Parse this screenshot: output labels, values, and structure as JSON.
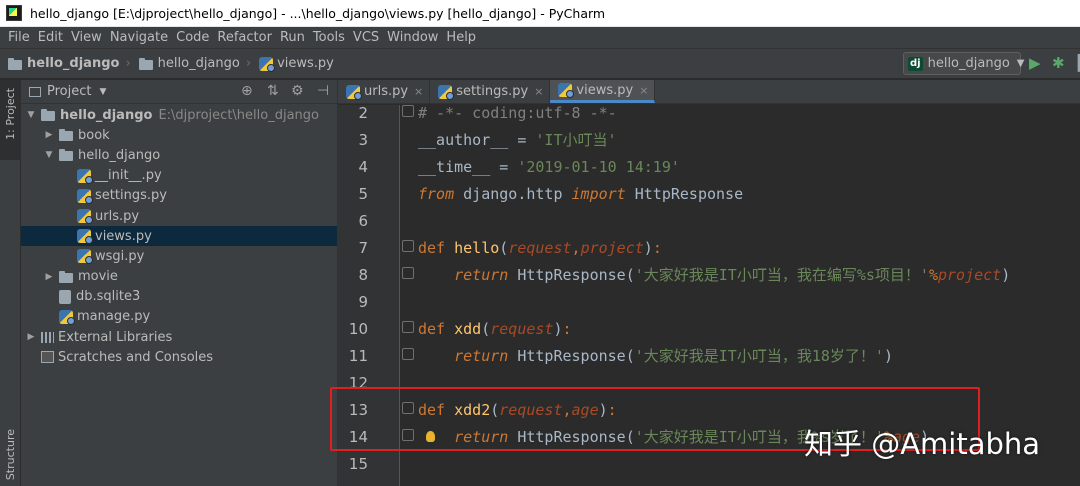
{
  "window": {
    "title": "hello_django [E:\\djproject\\hello_django] - ...\\hello_django\\views.py [hello_django] - PyCharm"
  },
  "menubar": {
    "items": [
      "File",
      "Edit",
      "View",
      "Navigate",
      "Code",
      "Refactor",
      "Run",
      "Tools",
      "VCS",
      "Window",
      "Help"
    ]
  },
  "breadcrumbs": [
    "hello_django",
    "hello_django",
    "views.py"
  ],
  "run_config": {
    "label": "hello_django",
    "badge": "dj"
  },
  "side_tabs": {
    "project": "1: Project",
    "structure": "Structure"
  },
  "project_panel": {
    "header": "Project",
    "tree": [
      {
        "label": "hello_django",
        "path": "E:\\djproject\\hello_django",
        "icon": "folder-icon",
        "expanded": true,
        "depth": 0,
        "bold": true
      },
      {
        "label": "book",
        "icon": "folder-icon",
        "expanded": false,
        "depth": 1
      },
      {
        "label": "hello_django",
        "icon": "folder-icon",
        "expanded": true,
        "depth": 1
      },
      {
        "label": "__init__.py",
        "icon": "python-file-icon",
        "depth": 2
      },
      {
        "label": "settings.py",
        "icon": "python-file-icon",
        "depth": 2
      },
      {
        "label": "urls.py",
        "icon": "python-file-icon",
        "depth": 2
      },
      {
        "label": "views.py",
        "icon": "python-file-icon",
        "depth": 2,
        "selected": true
      },
      {
        "label": "wsgi.py",
        "icon": "python-file-icon",
        "depth": 2
      },
      {
        "label": "movie",
        "icon": "folder-icon",
        "expanded": false,
        "depth": 1
      },
      {
        "label": "db.sqlite3",
        "icon": "database-icon",
        "depth": 1
      },
      {
        "label": "manage.py",
        "icon": "python-file-icon",
        "depth": 1
      },
      {
        "label": "External Libraries",
        "icon": "library-icon",
        "expanded": false,
        "depth": 0
      },
      {
        "label": "Scratches and Consoles",
        "icon": "scratch-icon",
        "depth": 0
      }
    ]
  },
  "editor": {
    "tabs": [
      {
        "label": "urls.py",
        "active": false
      },
      {
        "label": "settings.py",
        "active": false
      },
      {
        "label": "views.py",
        "active": true
      }
    ],
    "lines": [
      {
        "no": "2",
        "tokens": [
          [
            "c-comment",
            "# -*- coding:utf-8 -*-"
          ]
        ],
        "fold": true
      },
      {
        "no": "3",
        "tokens": [
          [
            "c-dunder",
            "__author__"
          ],
          [
            "",
            " = "
          ],
          [
            "c-str",
            "'IT小叮当'"
          ]
        ]
      },
      {
        "no": "4",
        "tokens": [
          [
            "c-dunder",
            "__time__"
          ],
          [
            "",
            " = "
          ],
          [
            "c-str",
            "'2019-01-10 14:19'"
          ]
        ]
      },
      {
        "no": "5",
        "tokens": [
          [
            "c-kw",
            "from"
          ],
          [
            "",
            " django.http "
          ],
          [
            "c-kw",
            "import"
          ],
          [
            "",
            " HttpResponse"
          ]
        ]
      },
      {
        "no": "6",
        "tokens": []
      },
      {
        "no": "7",
        "tokens": [
          [
            "c-kwplain",
            "def "
          ],
          [
            "c-fn",
            "hello"
          ],
          [
            "",
            "("
          ],
          [
            "c-param",
            "request"
          ],
          [
            "c-kwplain",
            ","
          ],
          [
            "c-param",
            "project"
          ],
          [
            "",
            ")"
          ],
          [
            "c-kwplain",
            ":"
          ]
        ],
        "fold": true
      },
      {
        "no": "8",
        "tokens": [
          [
            "",
            "    "
          ],
          [
            "c-kw",
            "return"
          ],
          [
            "",
            " HttpResponse("
          ],
          [
            "c-str",
            "'大家好我是IT小叮当，我在编写%s项目！'"
          ],
          [
            "c-kwplain",
            "%"
          ],
          [
            "c-param",
            "project"
          ],
          [
            "",
            ")"
          ]
        ],
        "fold": true
      },
      {
        "no": "9",
        "tokens": []
      },
      {
        "no": "10",
        "tokens": [
          [
            "c-kwplain",
            "def "
          ],
          [
            "c-fn",
            "xdd"
          ],
          [
            "",
            "("
          ],
          [
            "c-param",
            "request"
          ],
          [
            "",
            ")"
          ],
          [
            "c-kwplain",
            ":"
          ]
        ],
        "fold": true
      },
      {
        "no": "11",
        "tokens": [
          [
            "",
            "    "
          ],
          [
            "c-kw",
            "return"
          ],
          [
            "",
            " HttpResponse("
          ],
          [
            "c-str",
            "'大家好我是IT小叮当，我18岁了！'"
          ],
          [
            "",
            ")"
          ]
        ],
        "fold": true
      },
      {
        "no": "12",
        "tokens": []
      },
      {
        "no": "13",
        "tokens": [
          [
            "c-kwplain",
            "def "
          ],
          [
            "c-fn",
            "xdd2"
          ],
          [
            "",
            "("
          ],
          [
            "c-param",
            "request"
          ],
          [
            "c-kwplain",
            ","
          ],
          [
            "c-param",
            "age"
          ],
          [
            "",
            ")"
          ],
          [
            "c-kwplain",
            ":"
          ]
        ],
        "fold": true
      },
      {
        "no": "14",
        "tokens": [
          [
            "",
            "    "
          ],
          [
            "c-kw",
            "return"
          ],
          [
            "",
            " HttpResponse("
          ],
          [
            "c-str",
            "'大家好我是IT小叮当，我%s岁了！'"
          ],
          [
            "c-kwplain",
            "%"
          ],
          [
            "c-param",
            "age"
          ],
          [
            "",
            ")"
          ]
        ],
        "fold": true,
        "bulb": true
      },
      {
        "no": "15",
        "tokens": []
      }
    ]
  },
  "watermark": "知乎 @Amitabha",
  "colors": {
    "keyword": "#cc7832",
    "string": "#6a8759",
    "function": "#ffc66d",
    "parameter": "#aa4926",
    "comment": "#808080",
    "highlight_box": "#e02020"
  }
}
